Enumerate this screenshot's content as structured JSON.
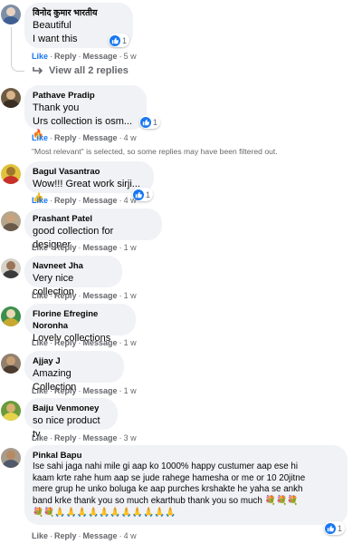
{
  "actions": {
    "like": "Like",
    "reply": "Reply",
    "message": "Message",
    "sep": "·"
  },
  "comments": [
    {
      "author": "विनोद कुमार भारतीय",
      "lines": [
        "Beautiful",
        "I want this"
      ],
      "time": "5 w",
      "reaction_count": "1",
      "avatar_colors": {
        "bg": "#7d8fa6",
        "head": "#e7d2c0",
        "body": "#3f5f93"
      }
    },
    {
      "author": "Pathave Pradip",
      "lines": [
        "Thank you",
        "Urs collection is osm..."
      ],
      "emoji": "🔥",
      "time": "4 w",
      "reaction_count": "1",
      "avatar_colors": {
        "bg": "#6e5b43",
        "head": "#d9b48a",
        "body": "#3a2e22"
      }
    },
    {
      "author": "Bagul Vasantrao",
      "lines": [
        "Wow!!! Great work sirji..."
      ],
      "emoji": "👍",
      "time": "4 w",
      "reaction_count": "1",
      "avatar_colors": {
        "bg": "#e0c23c",
        "head": "#a0762e",
        "body": "#c8302b"
      }
    },
    {
      "author": "Prashant Patel",
      "lines": [
        "good collection for designer"
      ],
      "time": "1 w",
      "avatar_colors": {
        "bg": "#b5a68e",
        "head": "#caa27c",
        "body": "#6a5a4a"
      }
    },
    {
      "author": "Navneet Jha",
      "lines": [
        "Very nice collection"
      ],
      "time": "1 w",
      "avatar_colors": {
        "bg": "#d7d2c9",
        "head": "#9b7457",
        "body": "#3a3a3a"
      }
    },
    {
      "author": "Florine Efregine Noronha",
      "lines": [
        "Lovely collections"
      ],
      "time": "1 w",
      "avatar_colors": {
        "bg": "#3d8f4b",
        "head": "#e9d8b5",
        "body": "#c9a82f"
      }
    },
    {
      "author": "Ajjay J",
      "lines": [
        "Amazing Collection"
      ],
      "time": "1 w",
      "avatar_colors": {
        "bg": "#90806e",
        "head": "#c79d74",
        "body": "#4b3c2f"
      }
    },
    {
      "author": "Baiju Venmoney",
      "lines": [
        "so nice product ty"
      ],
      "time": "3 w",
      "avatar_colors": {
        "bg": "#6a9a3c",
        "head": "#d8b070",
        "body": "#e7d34a"
      }
    },
    {
      "author": "Pinkal Bapu",
      "lines": [
        "Ise sahi jaga nahi mile gi aap ko 1000% happy custumer aap ese hi",
        "kaam krte rahe hum aap se jude rahege hamesha or me or 10 20jitne",
        "mere grup he unko boluga ke aap purches krshakte he yaha se ankh",
        "band krke thank you so much ekarthub thank you so much"
      ],
      "emoji_trail": "💐💐💐",
      "emoji_line": "💐💐🙏🙏🙏🙏🙏🙏🙏🙏🙏🙏🙏",
      "time": "4 w",
      "reaction_count": "1",
      "avatar_colors": {
        "bg": "#a69b8d",
        "head": "#b88a62",
        "body": "#505a6a"
      }
    }
  ],
  "view_all_replies": "View all 2 replies",
  "filter_notice": "\"Most relevant\" is selected, so some replies may have been filtered out.",
  "colors": {
    "like_blue": "#1877f2",
    "meta_gray": "#65676b",
    "bubble_bg": "#f0f2f5"
  }
}
